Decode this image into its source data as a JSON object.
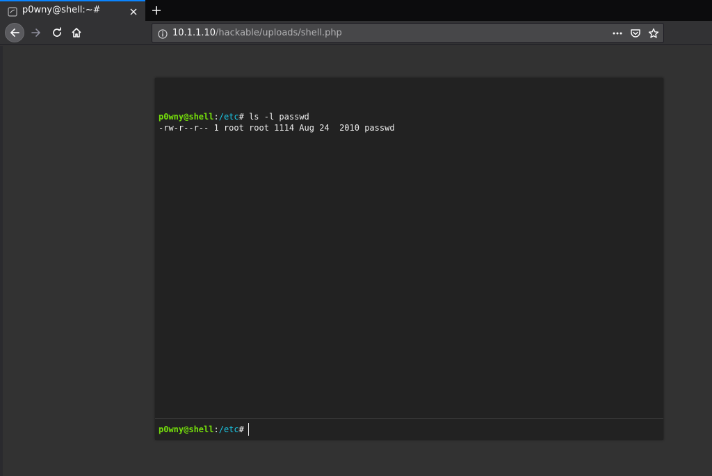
{
  "tab": {
    "title": "p0wny@shell:~#",
    "favicon": "page-icon"
  },
  "toolbar": {
    "icons": [
      "back-arrow-icon",
      "forward-arrow-icon",
      "reload-icon",
      "home-icon"
    ]
  },
  "urlbar": {
    "host": "10.1.1.10",
    "path": "/hackable/uploads/shell.php",
    "actions": [
      "more-icon",
      "pocket-icon",
      "bookmark-star-icon"
    ]
  },
  "shell": {
    "history": [
      {
        "prompt_user": "p0wny@shell",
        "prompt_sep": ":",
        "prompt_cwd": "/etc",
        "prompt_hash": "#",
        "command": " ls -l passwd",
        "output": "-rw-r--r-- 1 root root 1114 Aug 24  2010 passwd"
      }
    ],
    "input_prompt": {
      "user": "p0wny@shell",
      "sep": ":",
      "cwd": "/etc",
      "hash": "#"
    },
    "input_value": ""
  },
  "colors": {
    "prompt_user": "#75df0b",
    "prompt_cwd": "#1bc9e7",
    "shell_bg": "#222222",
    "page_bg": "#323232",
    "tab_accent": "#0a84ff"
  }
}
